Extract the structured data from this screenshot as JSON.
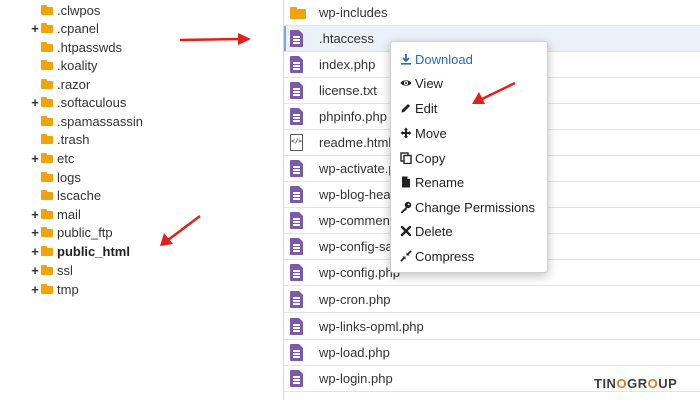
{
  "tree": {
    "items": [
      {
        "label": ".clwpos",
        "expander": ""
      },
      {
        "label": ".cpanel",
        "expander": "+"
      },
      {
        "label": ".htpasswds",
        "expander": ""
      },
      {
        "label": ".koality",
        "expander": ""
      },
      {
        "label": ".razor",
        "expander": ""
      },
      {
        "label": ".softaculous",
        "expander": "+"
      },
      {
        "label": ".spamassassin",
        "expander": ""
      },
      {
        "label": ".trash",
        "expander": ""
      },
      {
        "label": "etc",
        "expander": "+"
      },
      {
        "label": "logs",
        "expander": ""
      },
      {
        "label": "lscache",
        "expander": ""
      },
      {
        "label": "mail",
        "expander": "+"
      },
      {
        "label": "public_ftp",
        "expander": "+"
      },
      {
        "label": "public_html",
        "expander": "+"
      },
      {
        "label": "ssl",
        "expander": "+"
      },
      {
        "label": "tmp",
        "expander": "+"
      }
    ]
  },
  "files": [
    {
      "name": "wp-includes",
      "icon": "folder-icon"
    },
    {
      "name": ".htaccess",
      "icon": "file-icon"
    },
    {
      "name": "index.php",
      "icon": "file-icon"
    },
    {
      "name": "license.txt",
      "icon": "file-icon"
    },
    {
      "name": "phpinfo.php",
      "icon": "file-icon"
    },
    {
      "name": "readme.html",
      "icon": "code-file-icon"
    },
    {
      "name": "wp-activate.p",
      "icon": "file-icon"
    },
    {
      "name": "wp-blog-head",
      "icon": "file-icon"
    },
    {
      "name": "wp-comments-",
      "icon": "file-icon"
    },
    {
      "name": "wp-config-sar",
      "icon": "file-icon"
    },
    {
      "name": "wp-config.php",
      "icon": "file-icon"
    },
    {
      "name": "wp-cron.php",
      "icon": "file-icon"
    },
    {
      "name": "wp-links-opml.php",
      "icon": "file-icon"
    },
    {
      "name": "wp-load.php",
      "icon": "file-icon"
    },
    {
      "name": "wp-login.php",
      "icon": "file-icon"
    }
  ],
  "context_menu": {
    "items": [
      {
        "label": "Download",
        "icon": "download-icon"
      },
      {
        "label": "View",
        "icon": "eye-icon"
      },
      {
        "label": "Edit",
        "icon": "pencil-icon"
      },
      {
        "label": "Move",
        "icon": "move-icon"
      },
      {
        "label": "Copy",
        "icon": "copy-icon"
      },
      {
        "label": "Rename",
        "icon": "rename-icon"
      },
      {
        "label": "Change Permissions",
        "icon": "key-icon"
      },
      {
        "label": "Delete",
        "icon": "delete-icon"
      },
      {
        "label": "Compress",
        "icon": "compress-icon"
      }
    ]
  },
  "watermark": {
    "part1": "TIN",
    "o": "O",
    "part2": "GR",
    "o2": "O",
    "part3": "UP"
  },
  "colors": {
    "folder": "#f0a30a",
    "file": "#7b5ba8",
    "arrow": "#e0201b",
    "link": "#2a6ab3"
  }
}
